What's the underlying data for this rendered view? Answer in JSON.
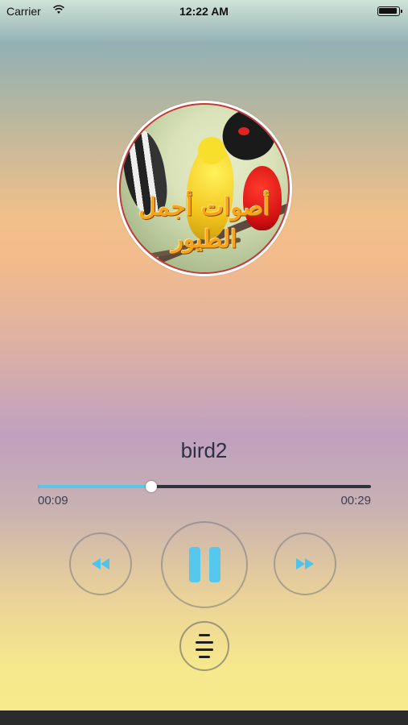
{
  "status_bar": {
    "carrier": "Carrier",
    "time": "12:22 AM",
    "icons": [
      "wifi-icon",
      "battery-icon"
    ]
  },
  "album": {
    "title_line1": "أصوات أجمل",
    "title_line2": "الطيور"
  },
  "player": {
    "track_title": "bird2",
    "elapsed": "00:09",
    "total": "00:29",
    "progress_percent": 34,
    "accent_color": "#5bc6e8"
  },
  "controls": {
    "icons": [
      "rewind-icon",
      "pause-icon",
      "fast-forward-icon",
      "playlist-icon"
    ]
  }
}
